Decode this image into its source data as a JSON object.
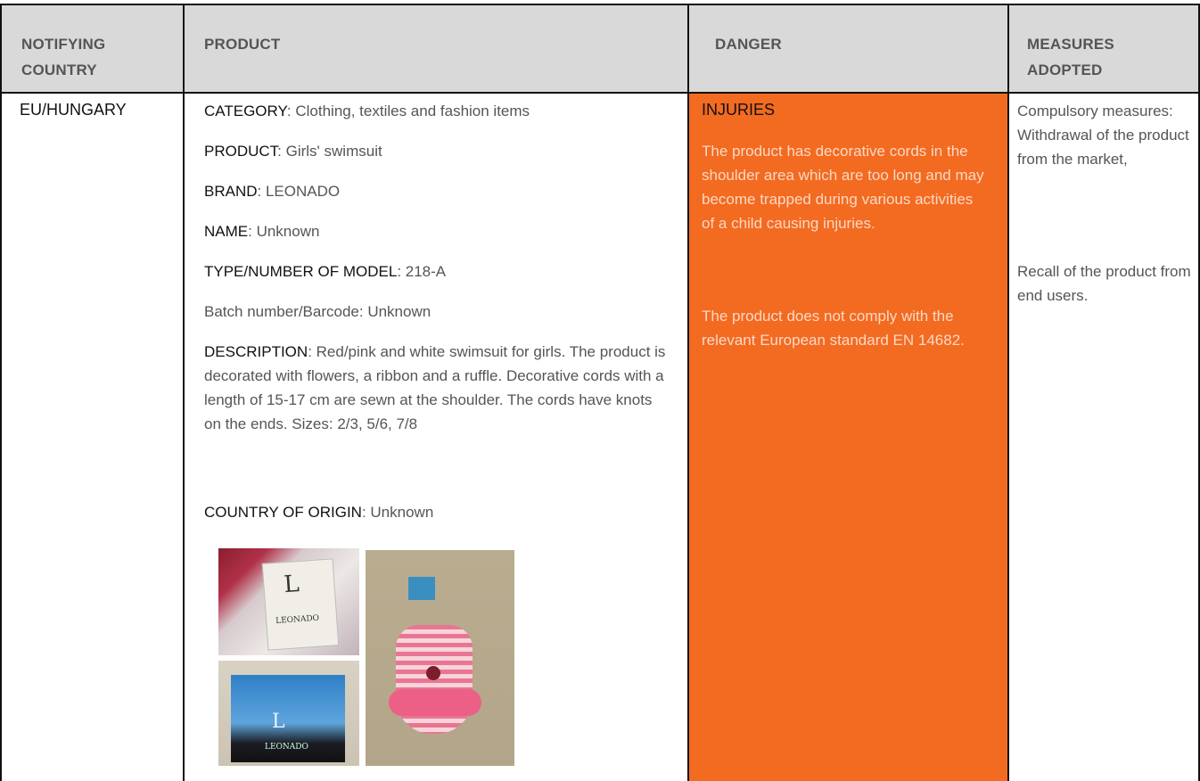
{
  "headers": {
    "country": "NOTIFYING COUNTRY",
    "product": "PRODUCT",
    "danger": "DANGER",
    "measures": "MEASURES ADOPTED"
  },
  "row": {
    "country": "EU/HUNGARY",
    "product": {
      "category_label": "CATEGORY",
      "category_value": ": Clothing, textiles and fashion items",
      "product_label": "PRODUCT",
      "product_value": ": Girls' swimsuit",
      "brand_label": "BRAND",
      "brand_value": ": LEONADO",
      "name_label": "NAME",
      "name_value": ": Unknown",
      "type_label": "TYPE/NUMBER OF MODEL",
      "type_value": ": 218-A",
      "batch": "Batch number/Barcode: Unknown",
      "description_label": "DESCRIPTION",
      "description_value": ": Red/pink and white swimsuit for girls. The product is decorated with flowers, a ribbon and a ruffle. Decorative cords with a length of 15-17 cm are sewn at the shoulder. The cords have knots on the ends. Sizes: 2/3, 5/6, 7/8",
      "origin_label": "COUNTRY OF ORIGIN",
      "origin_value": ": Unknown"
    },
    "danger": {
      "title": "INJURIES",
      "paragraph1": "The product has decorative cords in the shoulder area which are too long and may become trapped during various activities of a child causing injuries.",
      "paragraph2": "The product does not comply with the relevant European standard EN 14682."
    },
    "measures": {
      "paragraph1": "Compulsory measures: Withdrawal of the product from the market,",
      "paragraph2": "Recall of the product from end users."
    }
  },
  "photos": {
    "label_logo": "L",
    "label_text": "LEONADO",
    "tag_logo": "L",
    "tag_text": "LEONADO"
  },
  "colors": {
    "header_bg": "#d9d9d9",
    "danger_bg": "#f36a21",
    "danger_text": "#fbd9c4"
  }
}
